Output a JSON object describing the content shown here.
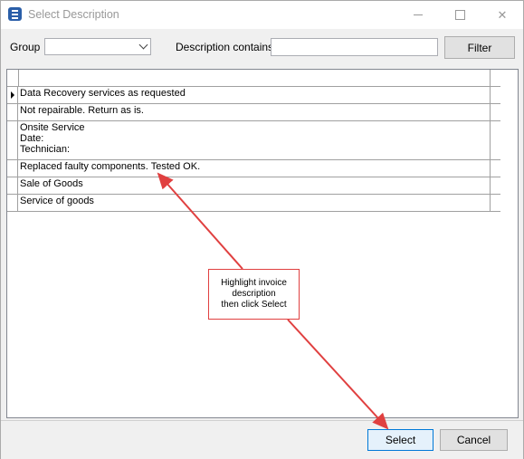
{
  "window": {
    "title": "Select Description"
  },
  "toolbar": {
    "group_label": "Group",
    "group_value": "",
    "description_label": "Description contains:",
    "description_value": "",
    "filter_label": "Filter"
  },
  "grid": {
    "rows": [
      {
        "text": "Data Recovery services as requested",
        "current": true
      },
      {
        "text": "Not repairable. Return as is.",
        "current": false
      },
      {
        "text": "Onsite Service\nDate:\nTechnician:",
        "current": false
      },
      {
        "text": "Replaced faulty components. Tested OK.",
        "current": false
      },
      {
        "text": "Sale of Goods",
        "current": false
      },
      {
        "text": "Service of goods",
        "current": false
      }
    ]
  },
  "callout": {
    "text": "Highlight invoice\ndescription\nthen click Select"
  },
  "footer": {
    "select_label": "Select",
    "cancel_label": "Cancel"
  },
  "colors": {
    "annotation": "#e04040",
    "select_accent": "#0078d7"
  }
}
